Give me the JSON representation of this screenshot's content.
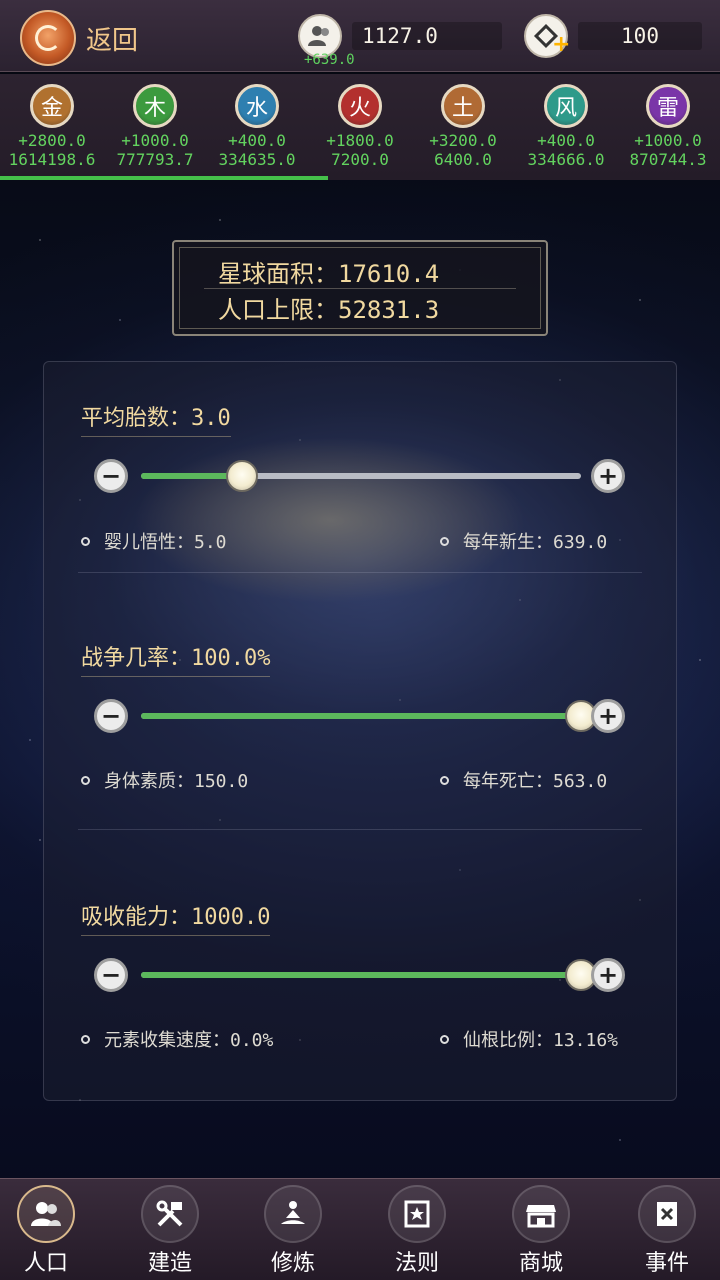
{
  "header": {
    "back_label": "返回",
    "population": "1127.0",
    "population_delta": "+639.0",
    "coins": "100"
  },
  "elements": [
    {
      "name": "金",
      "delta": "+2800.0",
      "total": "1614198.6",
      "color": "#b0712f"
    },
    {
      "name": "木",
      "delta": "+1000.0",
      "total": "777793.7",
      "color": "#3c9a3e"
    },
    {
      "name": "水",
      "delta": "+400.0",
      "total": "334635.0",
      "color": "#2e7fb0"
    },
    {
      "name": "火",
      "delta": "+1800.0",
      "total": "7200.0",
      "color": "#b3302e"
    },
    {
      "name": "土",
      "delta": "+3200.0",
      "total": "6400.0",
      "color": "#b06a34"
    },
    {
      "name": "风",
      "delta": "+400.0",
      "total": "334666.0",
      "color": "#2e9a8a"
    },
    {
      "name": "雷",
      "delta": "+1000.0",
      "total": "870744.3",
      "color": "#7a35a8"
    }
  ],
  "planet": {
    "area_label": "星球面积：17610.4",
    "pop_limit_label": "人口上限：52831.3"
  },
  "sliders": {
    "birth": {
      "title": "平均胎数：3.0",
      "level": 0.23,
      "stat_left": "婴儿悟性：5.0",
      "stat_right": "每年新生：639.0"
    },
    "war": {
      "title": "战争几率：100.0%",
      "level": 1.0,
      "stat_left": "身体素质：150.0",
      "stat_right": "每年死亡：563.0"
    },
    "absorb": {
      "title": "吸收能力：1000.0",
      "level": 1.0,
      "stat_left": "元素收集速度：0.0%",
      "stat_right": "仙根比例：13.16%"
    }
  },
  "nav": [
    {
      "label": "人口",
      "icon": "people-icon"
    },
    {
      "label": "建造",
      "icon": "tools-icon"
    },
    {
      "label": "修炼",
      "icon": "meditate-icon"
    },
    {
      "label": "法则",
      "icon": "scroll-icon"
    },
    {
      "label": "商城",
      "icon": "shop-icon"
    },
    {
      "label": "事件",
      "icon": "book-icon"
    }
  ]
}
